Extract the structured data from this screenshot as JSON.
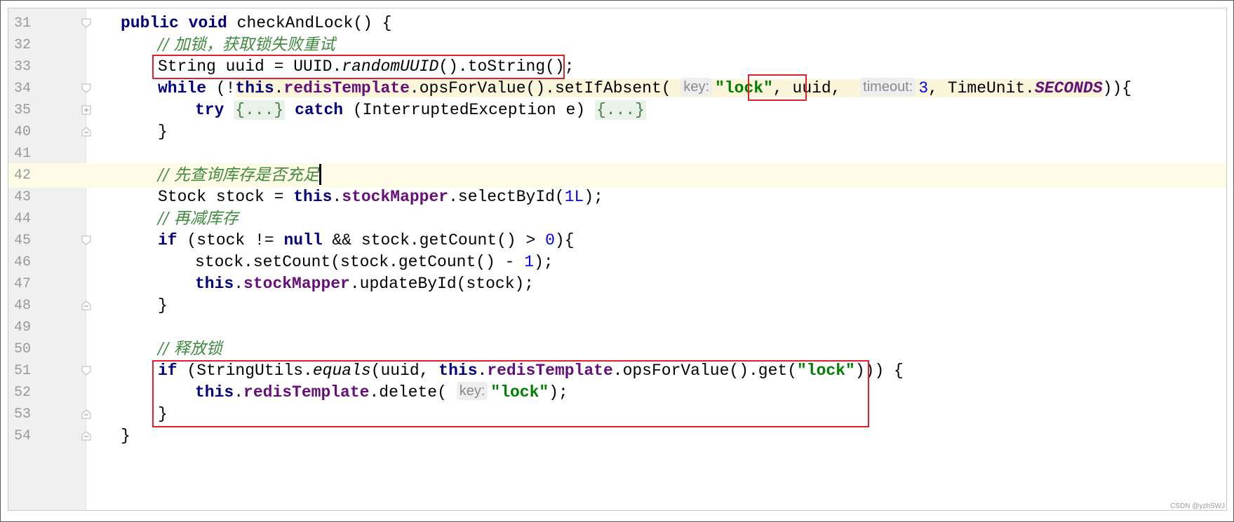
{
  "editor": {
    "line_numbers": [
      "31",
      "32",
      "33",
      "34",
      "35",
      "40",
      "41",
      "42",
      "43",
      "44",
      "45",
      "46",
      "47",
      "48",
      "49",
      "50",
      "51",
      "52",
      "53",
      "54"
    ],
    "current_line": "42"
  },
  "tokens": {
    "public": "public",
    "void": "void",
    "method_name": "checkAndLock",
    "paren_open_brace": "() {",
    "cmt_lock": "// 加锁，获取锁失败重试",
    "string_type": "String",
    "uuid_decl": " uuid = UUID.",
    "random_uuid": "randomUUID",
    "to_string": "().toString();",
    "while_kw": "while",
    "while_open": " (!",
    "this_kw": "this",
    "dot": ".",
    "redis_template": "redisTemplate",
    "ops_set_if_absent": ".opsForValue().setIfAbsent(",
    "hint_key": "key:",
    "lock_str": "\"lock\"",
    "comma": ",",
    "uuid_arg": " uuid,",
    "hint_timeout": "timeout:",
    "three": "3",
    "timeunit": ", TimeUnit.",
    "seconds": "SECONDS",
    "while_close": ")){",
    "try_kw": "try",
    "folded_block": "{...}",
    "catch_kw": "catch",
    "catch_args": " (InterruptedException e) ",
    "close_brace": "}",
    "cmt_check_stock": "// 先查询库存是否充足",
    "stock_decl": "Stock stock = ",
    "stock_mapper": "stockMapper",
    "select_by_id": ".selectById(",
    "one_l": "1L",
    "close_paren_semi": ");",
    "cmt_reduce": "// 再减库存",
    "if_kw": "if",
    "if_stock_open": " (stock != ",
    "null_kw": "null",
    "and_get_count": " && stock.getCount() > ",
    "zero": "0",
    "close_brace_open": "){",
    "set_count": "stock.setCount(stock.getCount() - ",
    "one": "1",
    "update_by_id": ".updateById(stock);",
    "cmt_release": "// 释放锁",
    "if_string_utils": " (StringUtils.",
    "equals": "equals",
    "uuid_comma": "(uuid, ",
    "ops_get": ".opsForValue().get(",
    "close_triple": "))) {",
    "delete_open": ".delete(",
    "close_semi": ");"
  },
  "watermark": "CSDN @yzhSWJ",
  "colors": {
    "keyword": "#000080",
    "field": "#660e7a",
    "string": "#008000",
    "number": "#0000ff",
    "comment": "#3f8a3f",
    "highlight_box": "#e0202a",
    "current_line": "#fefbe6"
  }
}
